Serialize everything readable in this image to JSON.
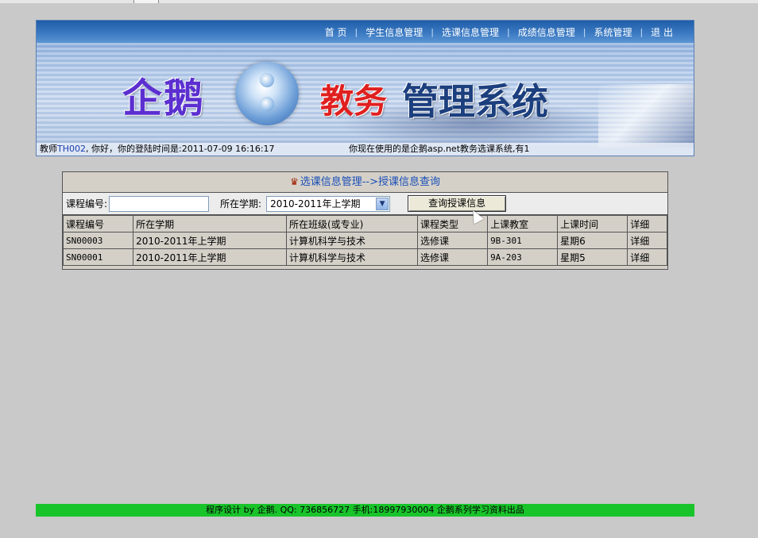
{
  "nav": {
    "items": [
      "首 页",
      "学生信息管理",
      "选课信息管理",
      "成绩信息管理",
      "系统管理",
      "退 出"
    ],
    "separator": "|"
  },
  "banner": {
    "logo_text": "企鹅",
    "title_red": "教务",
    "title_blue": "管理系统"
  },
  "status": {
    "prefix": "教师",
    "teacher_id": "TH002",
    "greeting": ", 你好，你的登陆时间是:2011-07-09 16:16:17",
    "using_text": "你现在使用的是企鹅asp.net教务选课系统,有1"
  },
  "panel": {
    "title_icon": "book-icon",
    "title": "选课信息管理-->授课信息查询",
    "course_label": "课程编号:",
    "course_value": "",
    "term_label": "所在学期:",
    "term_selected": "2010-2011年上学期",
    "query_button": "查询授课信息"
  },
  "table": {
    "headers": [
      "课程编号",
      "所在学期",
      "所在班级(或专业)",
      "课程类型",
      "上课教室",
      "上课时间",
      "详细"
    ],
    "rows": [
      [
        "SN00003",
        "2010-2011年上学期",
        "计算机科学与技术",
        "选修课",
        "9B-301",
        "星期6",
        "详细"
      ],
      [
        "SN00001",
        "2010-2011年上学期",
        "计算机科学与技术",
        "选修课",
        "9A-203",
        "星期5",
        "详细"
      ]
    ]
  },
  "footer": {
    "text": "程序设计 by 企鹅. QQ: 736856727 手机:18997930004 企鹅系列学习资料出品"
  },
  "colors": {
    "nav_bg": "#2f6cb8",
    "footer_bg": "#19c42b",
    "title_text": "#1a4fb8",
    "page_bg": "#c9c9c9"
  }
}
